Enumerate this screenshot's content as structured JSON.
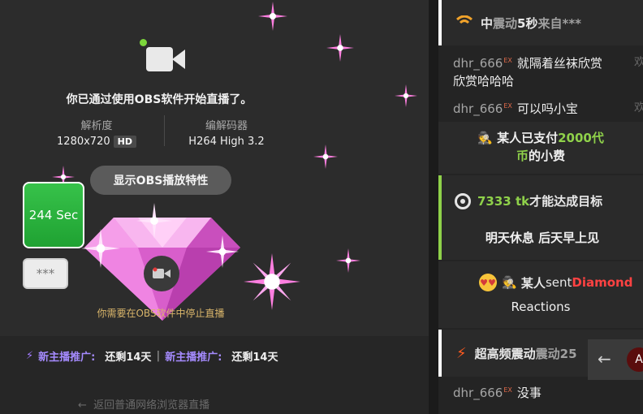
{
  "stream": {
    "obs_message": "你已通过使用OBS软件开始直播了。",
    "resolution_label": "解析度",
    "resolution_value": "1280x720",
    "hd_badge": "HD",
    "codec_label": "编解码器",
    "codec_value": "H264 High 3.2",
    "show_obs_button": "显示OBS播放特性",
    "timer_badge": "244 Sec",
    "masked_badge": "***",
    "stop_hint": "你需要在OBS软件中停止直播",
    "promo": {
      "label1": "新主播推广:",
      "value1": "还剩14天",
      "separator": "|",
      "label2": "新主播推广:",
      "value2": "还剩14天"
    },
    "back_link": "返回普通网络浏览器直播"
  },
  "chat": {
    "vibration_card": {
      "prefix": "中",
      "middle": "震动",
      "duration": "5秒",
      "suffix": "来自***"
    },
    "messages": [
      {
        "user": "dhr_666",
        "badge": "EX",
        "text": "就隔着丝袜欣赏",
        "text2": "欣赏哈哈哈"
      },
      {
        "user": "dhr_666",
        "badge": "EX",
        "text": "可以吗小宝"
      }
    ],
    "truncated_side": "欢",
    "tip": {
      "prefix": "某人已支付",
      "amount": "2000代",
      "amount2": "币",
      "suffix": "的小费"
    },
    "goal": {
      "amount": "7333 tk",
      "text": " 才能达成目标",
      "sub": "明天休息 后天早上见"
    },
    "reaction": {
      "who": "某人",
      "sent": " sent ",
      "item": "Diamond",
      "line2": "Reactions"
    },
    "high_vibration": {
      "label": "超高频震动",
      "rest": "震动25"
    },
    "last_message": {
      "user": "dhr_666",
      "badge": "EX",
      "text": "没事"
    },
    "overlay_avatar": "A"
  },
  "colors": {
    "accent_green": "#8fd14a",
    "accent_purple": "#a58bff",
    "diamond_red": "#ff4242",
    "timer_green": "#2db63f"
  },
  "icons": [
    "camera-icon",
    "wifi-icon",
    "target-icon",
    "bolt-icon",
    "emoji-icon",
    "spy-icon",
    "back-arrow-icon"
  ]
}
